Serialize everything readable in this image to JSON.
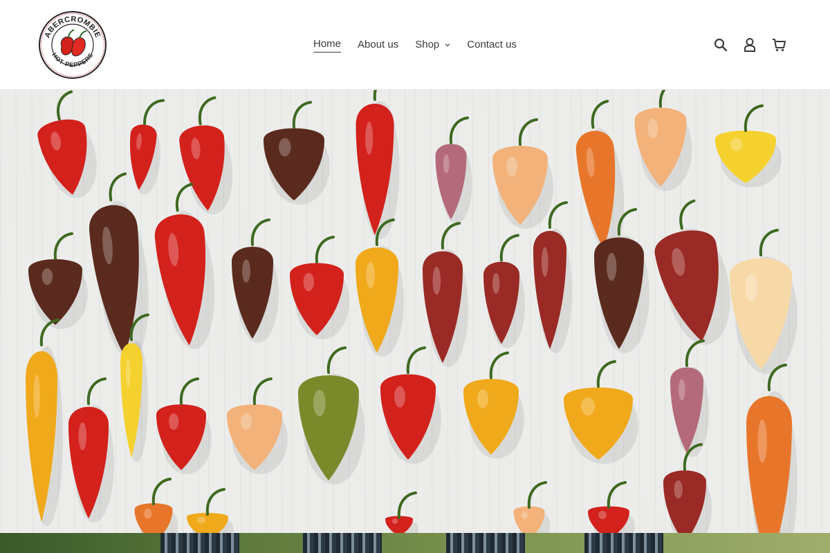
{
  "brand": {
    "logo_top_text": "ABERCROMBIE",
    "logo_bottom_text": "HOT PEPPERS",
    "logo_alt": "Abercrombie Hot Peppers logo",
    "accent_color": "#c8202a"
  },
  "nav": {
    "items": [
      {
        "label": "Home",
        "active": true
      },
      {
        "label": "About us",
        "active": false
      },
      {
        "label": "Shop",
        "active": false,
        "has_dropdown": true
      },
      {
        "label": "Contact us",
        "active": false
      }
    ]
  },
  "header_icons": [
    {
      "icon": "search-icon",
      "label": "Search"
    },
    {
      "icon": "user-icon",
      "label": "Log in"
    },
    {
      "icon": "cart-icon",
      "label": "Cart"
    }
  ],
  "hero": {
    "image_alt": "Assorted hot peppers arranged on white wood",
    "pepper_colors": [
      "#d3211c",
      "#5a2a1e",
      "#e8762a",
      "#f2b27a",
      "#f4d12e",
      "#f0a91a",
      "#7a8a2a",
      "#9a2a25",
      "#b46a7a",
      "#f7d9a8"
    ]
  }
}
